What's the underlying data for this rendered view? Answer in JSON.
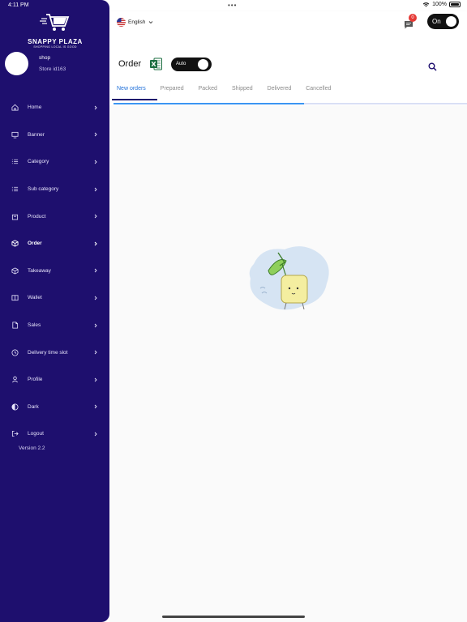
{
  "status_bar": {
    "time": "4:11 PM",
    "date": "Thu Apr 27",
    "battery": "100%"
  },
  "brand": {
    "name": "SNAPPY PLAZA",
    "tagline": "SHOPPING LOCAL IS GOOD"
  },
  "profile": {
    "name": "shop",
    "store": "Store id163"
  },
  "menu": [
    {
      "label": "Home",
      "icon": "home-icon"
    },
    {
      "label": "Banner",
      "icon": "monitor-icon"
    },
    {
      "label": "Category",
      "icon": "list-icon"
    },
    {
      "label": "Sub category",
      "icon": "list-icon"
    },
    {
      "label": "Product",
      "icon": "bag-icon"
    },
    {
      "label": "Order",
      "icon": "box-icon",
      "active": true
    },
    {
      "label": "Takeaway",
      "icon": "box-icon"
    },
    {
      "label": "Wallet",
      "icon": "wallet-icon"
    },
    {
      "label": "Sales",
      "icon": "document-icon"
    },
    {
      "label": "Delivery time slot",
      "icon": "clock-icon"
    },
    {
      "label": "Profile",
      "icon": "user-icon"
    },
    {
      "label": "Dark",
      "icon": "contrast-icon"
    },
    {
      "label": "Logout",
      "icon": "logout-icon",
      "no_chevron": true
    }
  ],
  "version": "Version 2.2",
  "topbar": {
    "language": "English",
    "notification_count": "0",
    "toggle_label": "On"
  },
  "page": {
    "title": "Order",
    "auto_label": "Auto",
    "tabs": [
      "New orders",
      "Prepared",
      "Packed",
      "Shipped",
      "Delivered",
      "Cancelled"
    ],
    "active_tab": 0,
    "loading_progress": 0.54
  },
  "colors": {
    "sidebar": "#1e0f6e",
    "accent": "#1e6fd9",
    "progress": "#3a95f2",
    "badge": "#e53935"
  }
}
